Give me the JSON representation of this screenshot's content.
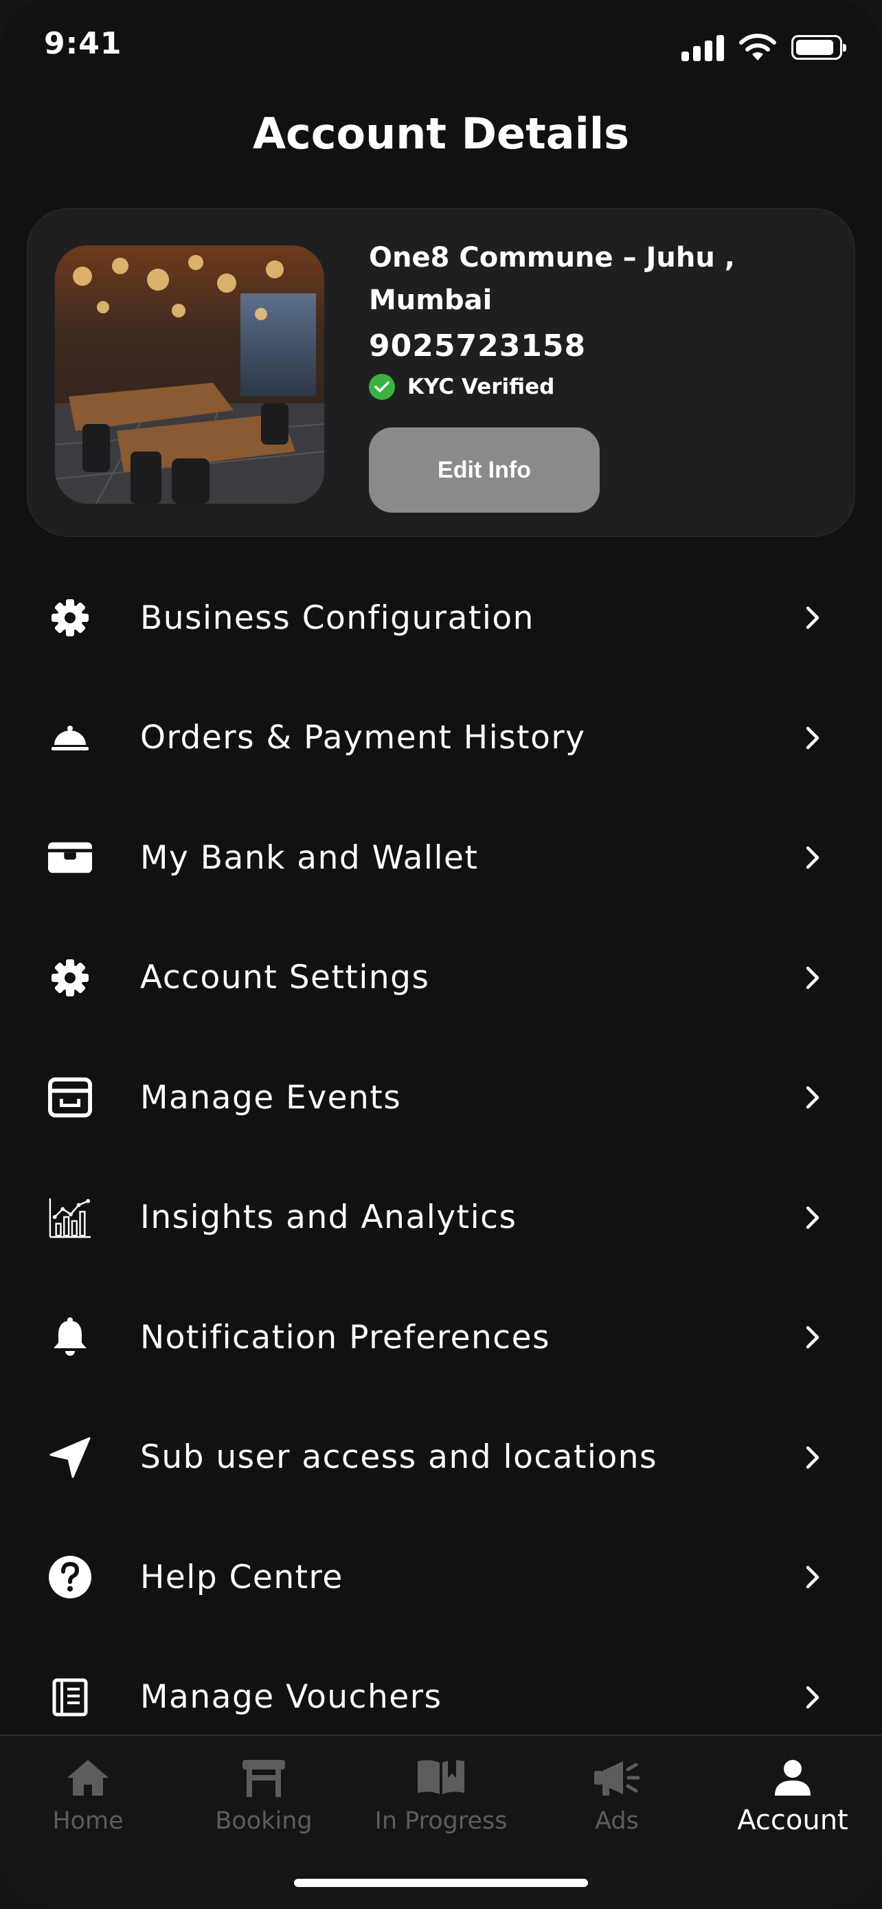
{
  "status_bar": {
    "time": "9:41"
  },
  "header": {
    "title": "Account Details"
  },
  "profile": {
    "name": "One8 Commune  – Juhu , Mumbai",
    "phone": "9025723158",
    "kyc_status": "KYC Verified",
    "edit_label": "Edit Info"
  },
  "menu": {
    "items": [
      {
        "label": "Business Configuration",
        "icon": "gear-icon"
      },
      {
        "label": "Orders & Payment History",
        "icon": "cloche-icon"
      },
      {
        "label": "My Bank and Wallet",
        "icon": "wallet-icon"
      },
      {
        "label": "Account Settings",
        "icon": "gear-icon"
      },
      {
        "label": "Manage Events",
        "icon": "archive-box-icon"
      },
      {
        "label": "Insights and Analytics",
        "icon": "analytics-icon"
      },
      {
        "label": "Notification Preferences",
        "icon": "bell-icon"
      },
      {
        "label": "Sub user access and locations",
        "icon": "location-arrow-icon"
      },
      {
        "label": "Help Centre",
        "icon": "question-circle-icon"
      },
      {
        "label": "Manage Vouchers",
        "icon": "voucher-book-icon"
      }
    ]
  },
  "bottom_nav": {
    "items": [
      {
        "label": "Home",
        "icon": "home-icon",
        "active": false
      },
      {
        "label": "Booking",
        "icon": "table-icon",
        "active": false
      },
      {
        "label": "In Progress",
        "icon": "open-book-icon",
        "active": false
      },
      {
        "label": "Ads",
        "icon": "megaphone-icon",
        "active": false
      },
      {
        "label": "Account",
        "icon": "user-icon",
        "active": true
      }
    ]
  },
  "colors": {
    "background": "#111111",
    "card": "#1f1f21",
    "kyc_green": "#3cb043",
    "button_gray": "#8a8a8a",
    "nav_inactive": "#5d5d5d",
    "text": "#ffffff"
  }
}
